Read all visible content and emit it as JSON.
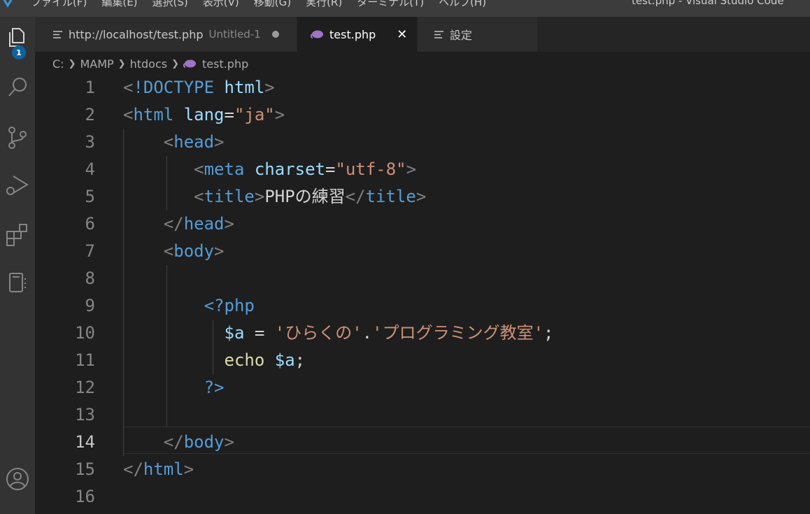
{
  "window": {
    "title": "test.php - Visual Studio Code",
    "menu": [
      "ファイル(F)",
      "編集(E)",
      "選択(S)",
      "表示(V)",
      "移動(G)",
      "実行(R)",
      "ターミナル(T)",
      "ヘルプ(H)"
    ]
  },
  "activity_bar": {
    "explorer_badge": "1",
    "icons": [
      "explorer-icon",
      "search-icon",
      "source-control-icon",
      "run-debug-icon",
      "extensions-icon",
      "remote-explorer-icon",
      "account-icon"
    ]
  },
  "tabs": [
    {
      "label": "http://localhost/test.php",
      "description": "Untitled-1",
      "icon": "lines-icon",
      "dirty": true,
      "active": false
    },
    {
      "label": "test.php",
      "icon": "php-icon",
      "active": true,
      "close": "✕"
    },
    {
      "label": "設定",
      "icon": "lines-icon",
      "active": false
    }
  ],
  "breadcrumb": [
    "C:",
    "MAMP",
    "htdocs",
    "test.php"
  ],
  "editor": {
    "current_line": 14,
    "lines": [
      {
        "n": "1",
        "tokens": [
          [
            "br",
            "<"
          ],
          [
            "tag",
            "!DOCTYPE"
          ],
          [
            "txt",
            " "
          ],
          [
            "attr",
            "html"
          ],
          [
            "br",
            ">"
          ]
        ]
      },
      {
        "n": "2",
        "tokens": [
          [
            "br",
            "<"
          ],
          [
            "tag",
            "html"
          ],
          [
            "txt",
            " "
          ],
          [
            "attr",
            "lang"
          ],
          [
            "txt",
            "="
          ],
          [
            "str",
            "\"ja\""
          ],
          [
            "br",
            ">"
          ]
        ]
      },
      {
        "n": "3",
        "tokens": [
          [
            "txt",
            "    "
          ],
          [
            "br",
            "<"
          ],
          [
            "tag",
            "head"
          ],
          [
            "br",
            ">"
          ]
        ]
      },
      {
        "n": "4",
        "tokens": [
          [
            "txt",
            "       "
          ],
          [
            "br",
            "<"
          ],
          [
            "tag",
            "meta"
          ],
          [
            "txt",
            " "
          ],
          [
            "attr",
            "charset"
          ],
          [
            "txt",
            "="
          ],
          [
            "str",
            "\"utf-8\""
          ],
          [
            "br",
            ">"
          ]
        ]
      },
      {
        "n": "5",
        "tokens": [
          [
            "txt",
            "       "
          ],
          [
            "br",
            "<"
          ],
          [
            "tag",
            "title"
          ],
          [
            "br",
            ">"
          ],
          [
            "txt",
            "PHPの練習"
          ],
          [
            "br",
            "</"
          ],
          [
            "tag",
            "title"
          ],
          [
            "br",
            ">"
          ]
        ]
      },
      {
        "n": "6",
        "tokens": [
          [
            "txt",
            "    "
          ],
          [
            "br",
            "</"
          ],
          [
            "tag",
            "head"
          ],
          [
            "br",
            ">"
          ]
        ]
      },
      {
        "n": "7",
        "tokens": [
          [
            "txt",
            "    "
          ],
          [
            "br",
            "<"
          ],
          [
            "tag",
            "body"
          ],
          [
            "br",
            ">"
          ]
        ]
      },
      {
        "n": "8",
        "tokens": []
      },
      {
        "n": "9",
        "tokens": [
          [
            "txt",
            "        "
          ],
          [
            "tag",
            "<?php"
          ]
        ]
      },
      {
        "n": "10",
        "tokens": [
          [
            "txt",
            "          "
          ],
          [
            "var",
            "$a"
          ],
          [
            "txt",
            " = "
          ],
          [
            "str",
            "'ひらくの'"
          ],
          [
            "txt",
            "."
          ],
          [
            "str",
            "'プログラミング教室'"
          ],
          [
            "txt",
            ";"
          ]
        ]
      },
      {
        "n": "11",
        "tokens": [
          [
            "txt",
            "          "
          ],
          [
            "fn",
            "echo"
          ],
          [
            "txt",
            " "
          ],
          [
            "var",
            "$a"
          ],
          [
            "txt",
            ";"
          ]
        ]
      },
      {
        "n": "12",
        "tokens": [
          [
            "txt",
            "        "
          ],
          [
            "tag",
            "?>"
          ]
        ]
      },
      {
        "n": "13",
        "tokens": []
      },
      {
        "n": "14",
        "tokens": [
          [
            "txt",
            "    "
          ],
          [
            "br",
            "</"
          ],
          [
            "tag",
            "body"
          ],
          [
            "br",
            ">"
          ]
        ]
      },
      {
        "n": "15",
        "tokens": [
          [
            "br",
            "</"
          ],
          [
            "tag",
            "html"
          ],
          [
            "br",
            ">"
          ]
        ]
      },
      {
        "n": "16",
        "tokens": []
      }
    ]
  }
}
